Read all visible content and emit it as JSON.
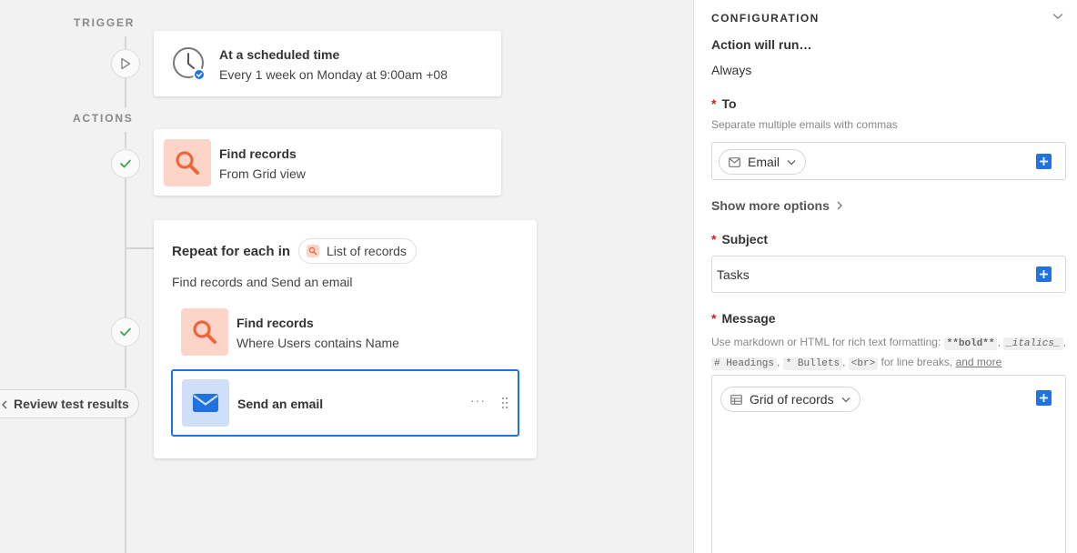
{
  "canvas": {
    "trigger_label": "TRIGGER",
    "actions_label": "ACTIONS",
    "trigger_card": {
      "title": "At a scheduled time",
      "subtitle": "Every 1 week on Monday at 9:00am +08",
      "icon": "clock-icon"
    },
    "find_card": {
      "title": "Find records",
      "subtitle": "From Grid view",
      "icon": "search-icon"
    },
    "repeat_card": {
      "prefix": "Repeat for each in",
      "pill_label": "List of records",
      "description": "Find records and Send an email",
      "nested_find": {
        "title": "Find records",
        "subtitle": "Where Users contains Name"
      },
      "send_email": {
        "title": "Send an email",
        "icon": "envelope-icon"
      }
    },
    "review_button": "Review test results"
  },
  "panel": {
    "config_title": "CONFIGURATION",
    "action_will_run": "Action will run…",
    "run_value": "Always",
    "to": {
      "label": "To",
      "help": "Separate multiple emails with commas",
      "chip": "Email"
    },
    "show_more": "Show more options",
    "subject": {
      "label": "Subject",
      "value": "Tasks"
    },
    "message": {
      "label": "Message",
      "help_prefix": "Use markdown or HTML for rich text formatting:",
      "code_bold": "**bold**",
      "code_italics": "_italics_",
      "code_headings": "# Headings",
      "code_bullets": "* Bullets",
      "code_br": "<br>",
      "help_linebreaks": "for line breaks,",
      "help_link": "and more",
      "chip": "Grid of records"
    },
    "colors": {
      "accent_blue": "#1f72e0",
      "required_red": "#d81b1b",
      "orange_icon": "#f0643a"
    }
  }
}
